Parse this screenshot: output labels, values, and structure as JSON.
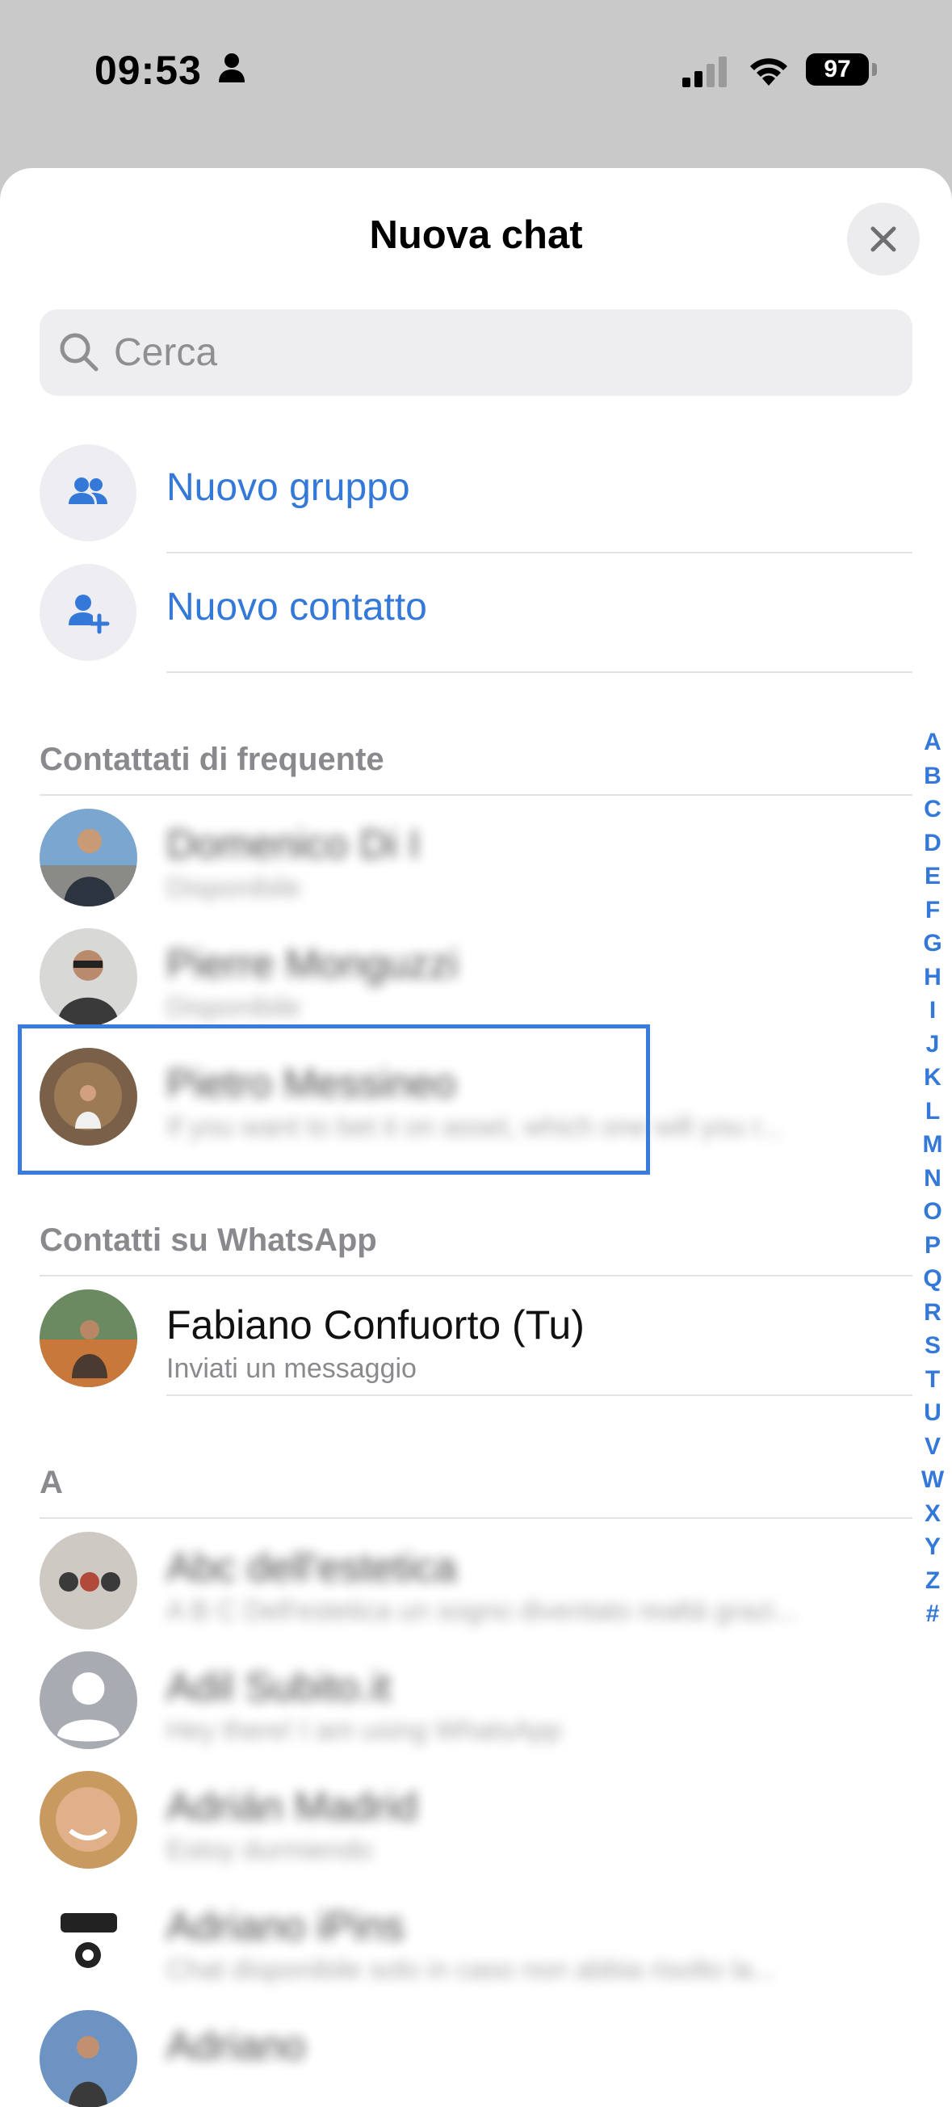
{
  "status_bar": {
    "time": "09:53",
    "battery": "97"
  },
  "sheet": {
    "title": "Nuova chat"
  },
  "search": {
    "placeholder": "Cerca"
  },
  "actions": [
    {
      "label": "Nuovo gruppo",
      "icon": "group-icon"
    },
    {
      "label": "Nuovo contatto",
      "icon": "add-contact-icon"
    }
  ],
  "sections": {
    "frequent": "Contattati di frequente",
    "whatsapp": "Contatti su WhatsApp",
    "a": "A"
  },
  "frequent_contacts": [
    {
      "name": "Domenico Di I",
      "sub": "Disponibile"
    },
    {
      "name": "Pierre Monguzzi",
      "sub": "Disponibile"
    },
    {
      "name": "Pietro Messineo",
      "sub": "If you want to bet it on asset, which one will you r..."
    }
  ],
  "whatsapp_contact": {
    "name": "Fabiano Confuorto (Tu)",
    "sub": "Inviati un messaggio"
  },
  "a_contacts": [
    {
      "name": "Abc dell'estetica",
      "sub": "A B C Dell'estetica un sogno diventato realtà grazi..."
    },
    {
      "name": "Adil Subito.it",
      "sub": "Hey there! I am using WhatsApp"
    },
    {
      "name": "Adrián Madrid",
      "sub": "Estoy durmiendo"
    },
    {
      "name": "Adriano iPins",
      "sub": "Chat disponibile solo in caso non abbia risolto la..."
    },
    {
      "name": "Adriano",
      "sub": ""
    }
  ],
  "alpha_index": [
    "A",
    "B",
    "C",
    "D",
    "E",
    "F",
    "G",
    "H",
    "I",
    "J",
    "K",
    "L",
    "M",
    "N",
    "O",
    "P",
    "Q",
    "R",
    "S",
    "T",
    "U",
    "V",
    "W",
    "X",
    "Y",
    "Z",
    "#"
  ],
  "colors": {
    "accent": "#3478d8",
    "highlight": "#3a7be0",
    "background": "#c9c9c9"
  }
}
